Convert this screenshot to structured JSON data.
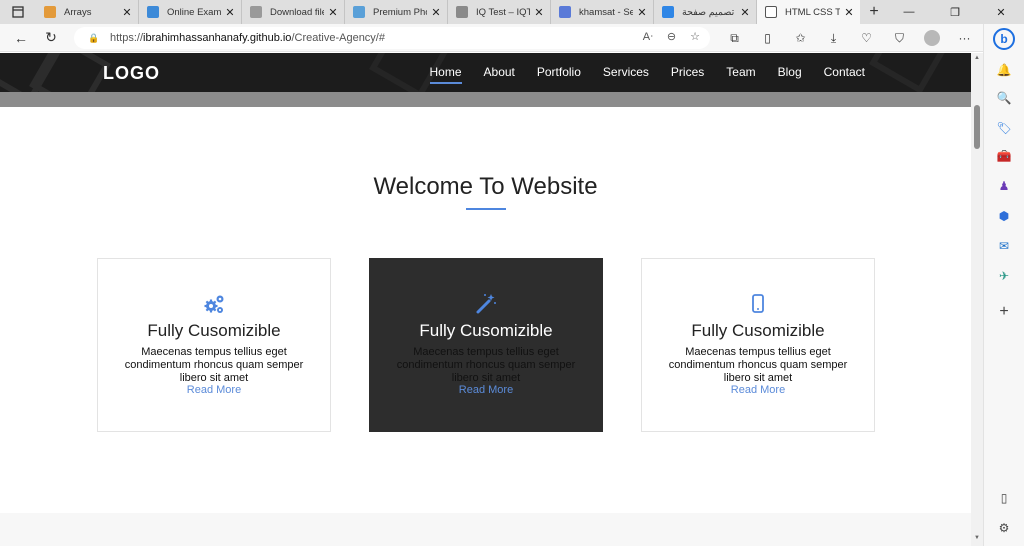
{
  "browser": {
    "tabs": [
      {
        "label": "Arrays",
        "color": "#e39a3a"
      },
      {
        "label": "Online Exam",
        "color": "#3d8ad8"
      },
      {
        "label": "Download file",
        "color": "#9a9a9a"
      },
      {
        "label": "Premium Pho",
        "color": "#5aa0d8"
      },
      {
        "label": "IQ Test – IQTe",
        "color": "#8a8a8a"
      },
      {
        "label": "khamsat - Se",
        "color": "#5a7ad8"
      },
      {
        "label": "تصميم صفحة",
        "color": "#2f86e6"
      },
      {
        "label": "HTML CSS Te",
        "color": "#ffffff"
      }
    ],
    "active_tab_index": 7,
    "url_scheme": "https://",
    "url_host": "ibrahimhassanhanafy.github.io",
    "url_path": "/Creative-Agency/#"
  },
  "site": {
    "logo": "LOGO",
    "nav": [
      "Home",
      "About",
      "Portfolio",
      "Services",
      "Prices",
      "Team",
      "Blog",
      "Contact"
    ],
    "section_title": "Welcome To Website",
    "accent": "#4e86df",
    "cards": [
      {
        "icon": "gears-icon",
        "title": "Fully Cusomizible",
        "text": "Maecenas tempus tellius eget condimentum rhoncus quam semper libero sit amet",
        "link": "Read More"
      },
      {
        "icon": "magic-wand-icon",
        "title": "Fully Cusomizible",
        "text": "Maecenas tempus tellius eget condimentum rhoncus quam semper libero sit amet",
        "link": "Read More"
      },
      {
        "icon": "mobile-icon",
        "title": "Fully Cusomizible",
        "text": "Maecenas tempus tellius eget condimentum rhoncus quam semper libero sit amet",
        "link": "Read More"
      }
    ]
  }
}
